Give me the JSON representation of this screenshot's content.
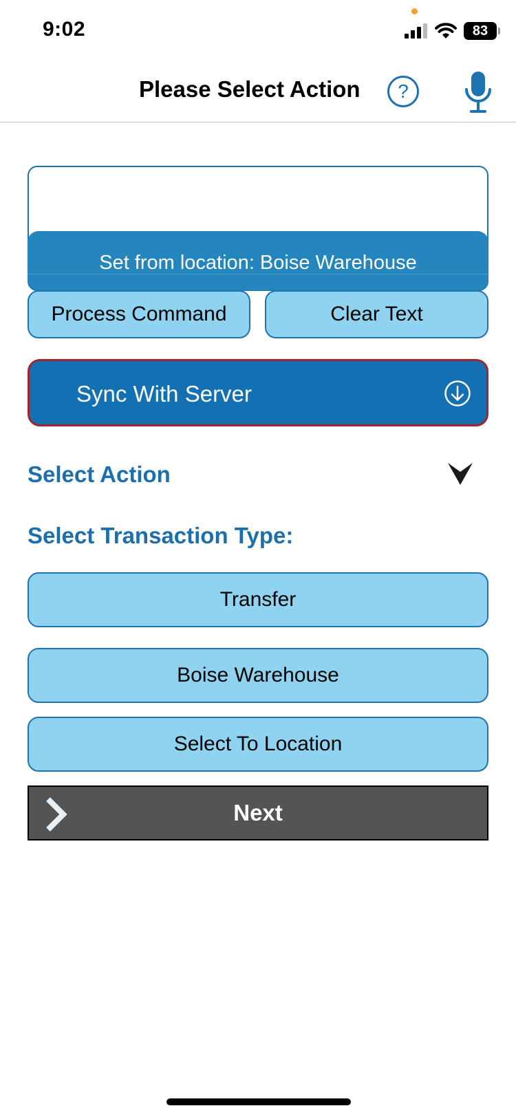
{
  "status_bar": {
    "time": "9:02",
    "battery": "83",
    "icons": [
      "cellular-signal-icon",
      "wifi-icon",
      "battery-icon"
    ]
  },
  "navbar": {
    "title": "Please Select Action",
    "help_symbol": "?",
    "icons": [
      "help-icon",
      "microphone-icon"
    ]
  },
  "command": {
    "input_value": "",
    "toast": "Set from location: Boise Warehouse",
    "process_label": "Process Command",
    "clear_label": "Clear Text"
  },
  "sync": {
    "label": "Sync With Server",
    "icon": "download-circle-icon"
  },
  "select_action": {
    "label": "Select Action",
    "icon": "chevron-down-icon"
  },
  "transaction": {
    "heading": "Select Transaction Type:",
    "type_label": "Transfer",
    "from_location_label": "Boise Warehouse",
    "to_location_label": "Select To Location"
  },
  "next": {
    "label": "Next",
    "icon": "chevron-right-icon"
  },
  "colors": {
    "accent_blue": "#1370b2",
    "light_button": "#8fd3f0",
    "toast": "#2586bd",
    "sync_border": "#a3242a",
    "next_bg": "#545454",
    "privacy_dot": "#f5a033"
  }
}
